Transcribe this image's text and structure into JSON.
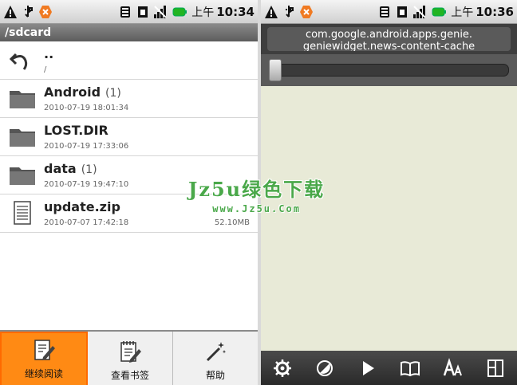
{
  "left_screen": {
    "status": {
      "am": "上午",
      "time": "10:34"
    },
    "path": "/sdcard",
    "files": [
      {
        "name": "..",
        "count": "",
        "date": "/",
        "size": "",
        "icon": "back-arrow-icon"
      },
      {
        "name": "Android",
        "count": "(1)",
        "date": "2010-07-19 18:01:34",
        "size": "",
        "icon": "folder-icon"
      },
      {
        "name": "LOST.DIR",
        "count": "",
        "date": "2010-07-19 17:33:06",
        "size": "",
        "icon": "folder-icon"
      },
      {
        "name": "data",
        "count": "(1)",
        "date": "2010-07-19 19:47:10",
        "size": "",
        "icon": "folder-icon"
      },
      {
        "name": "update.zip",
        "count": "",
        "date": "2010-07-07 17:42:18",
        "size": "52.10MB",
        "icon": "document-icon"
      }
    ],
    "menu": [
      {
        "label": "继续阅读",
        "icon": "edit-document-icon",
        "active": true
      },
      {
        "label": "查看书签",
        "icon": "bookmark-notes-icon",
        "active": false
      },
      {
        "label": "帮助",
        "icon": "magic-wand-icon",
        "active": false
      }
    ]
  },
  "right_screen": {
    "status": {
      "am": "上午",
      "time": "10:36"
    },
    "title_line1": "com.google.android.apps.genie.",
    "title_line2": "geniewidget.news-content-cache",
    "progress": 0,
    "toolbar": [
      "gear-icon",
      "contrast-icon",
      "play-icon",
      "book-icon",
      "font-size-icon",
      "layout-icon"
    ]
  },
  "watermark": {
    "title": "Jz5u绿色下载",
    "url": "www.Jz5u.Com"
  },
  "colors": {
    "accent_orange": "#ff8a14",
    "reader_bg": "#e8ead7",
    "watermark_green": "#4aa84a"
  }
}
